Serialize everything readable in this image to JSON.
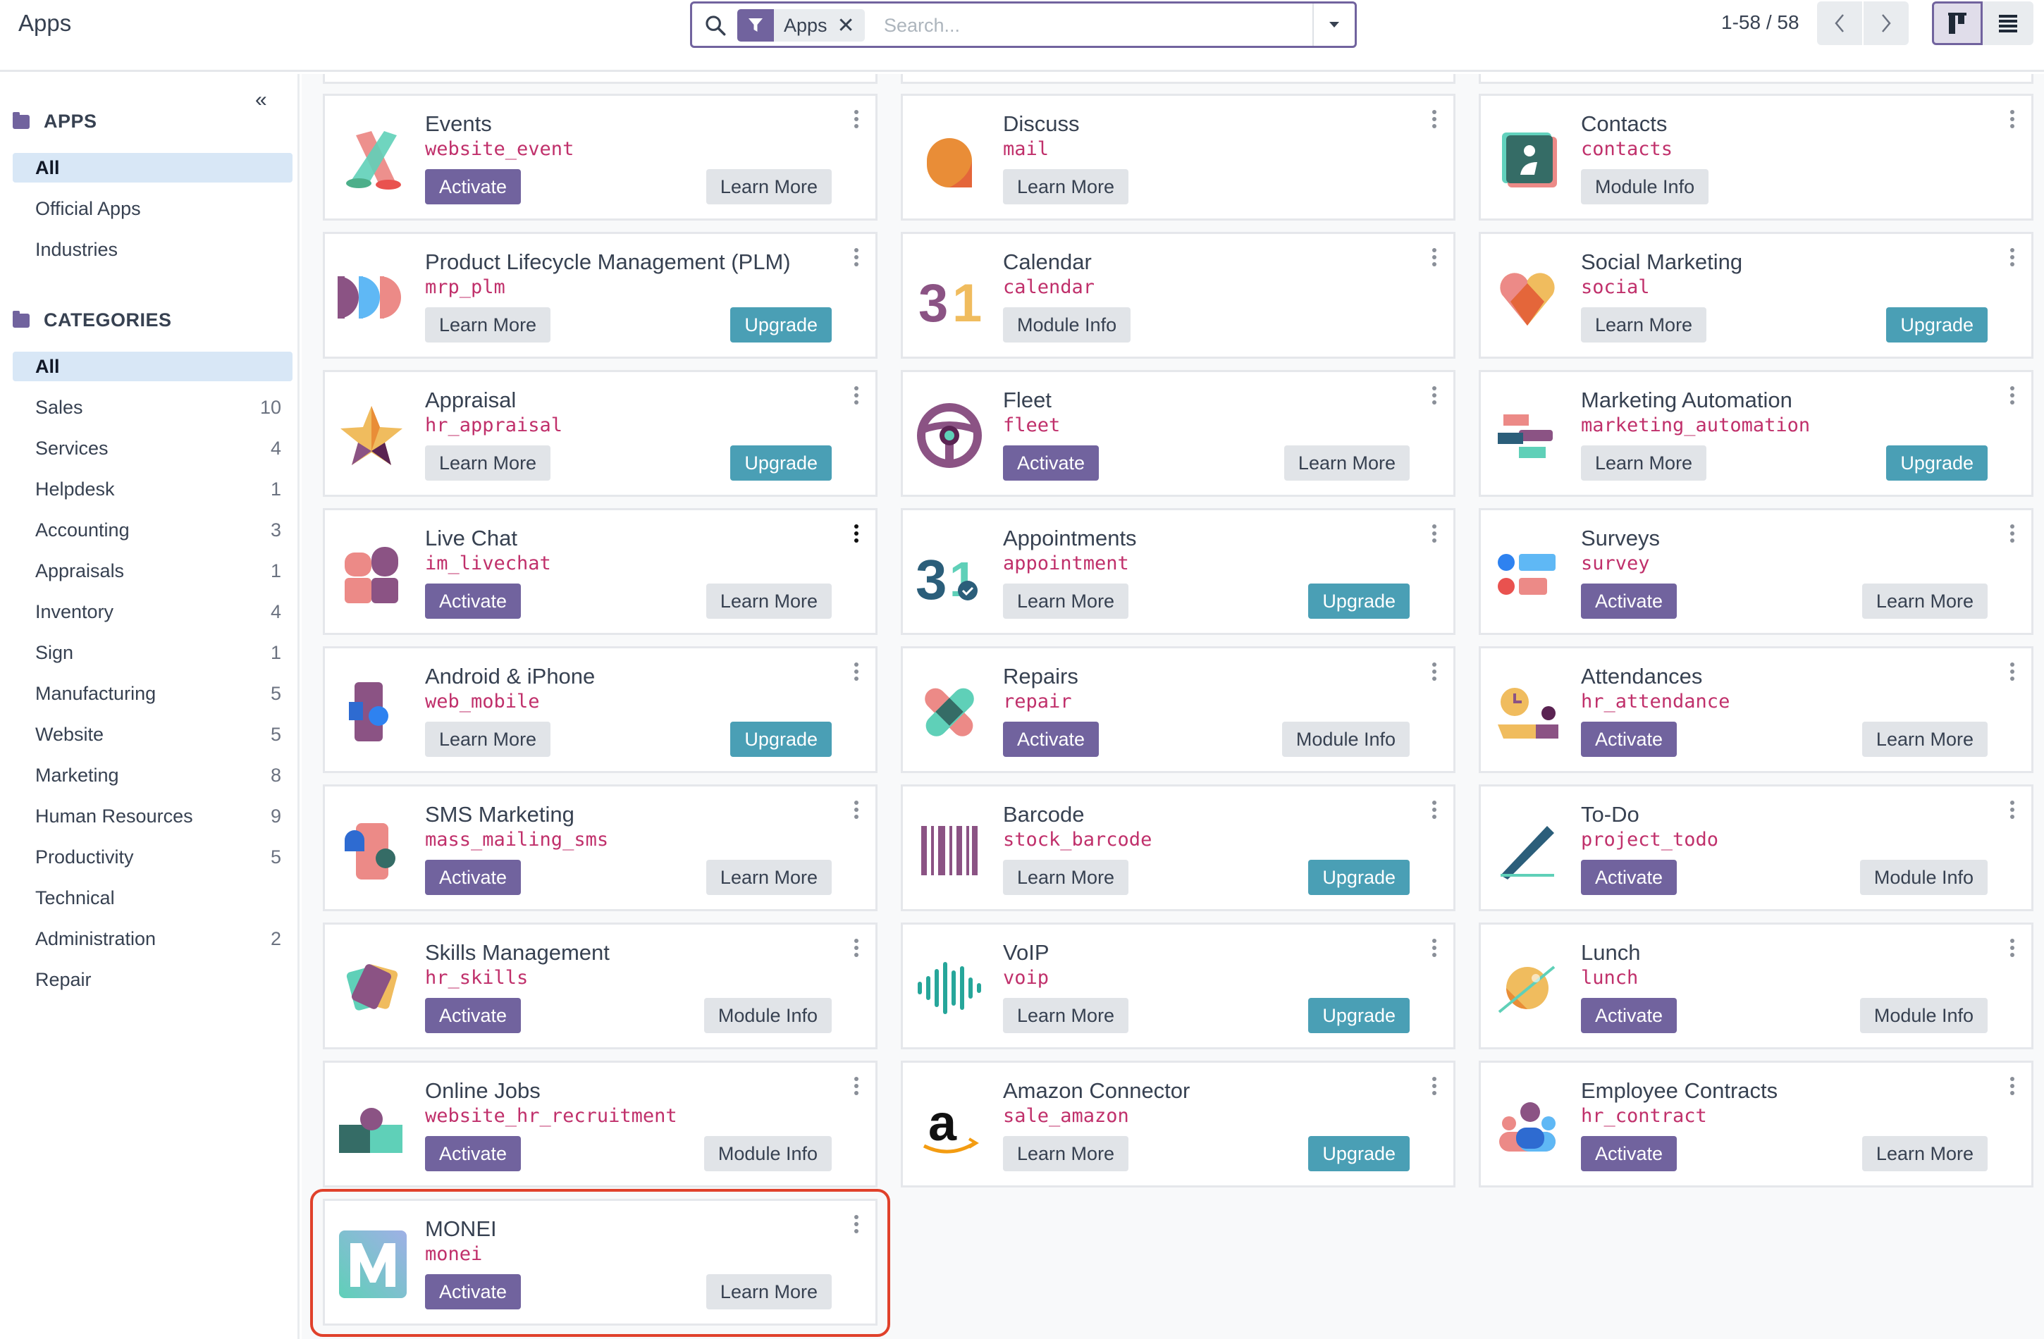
{
  "header": {
    "title": "Apps",
    "search": {
      "facet_label": "Apps",
      "placeholder": "Search...",
      "value": ""
    },
    "pager": "1-58 / 58"
  },
  "sidebar": {
    "apps_title": "APPS",
    "apps_items": [
      {
        "label": "All",
        "active": true
      },
      {
        "label": "Official Apps",
        "active": false
      },
      {
        "label": "Industries",
        "active": false
      }
    ],
    "categories_title": "CATEGORIES",
    "categories": [
      {
        "label": "All",
        "count": "",
        "active": true
      },
      {
        "label": "Sales",
        "count": "10"
      },
      {
        "label": "Services",
        "count": "4"
      },
      {
        "label": "Helpdesk",
        "count": "1"
      },
      {
        "label": "Accounting",
        "count": "3"
      },
      {
        "label": "Appraisals",
        "count": "1"
      },
      {
        "label": "Inventory",
        "count": "4"
      },
      {
        "label": "Sign",
        "count": "1"
      },
      {
        "label": "Manufacturing",
        "count": "5"
      },
      {
        "label": "Website",
        "count": "5"
      },
      {
        "label": "Marketing",
        "count": "8"
      },
      {
        "label": "Human Resources",
        "count": "9"
      },
      {
        "label": "Productivity",
        "count": "5"
      },
      {
        "label": "Technical",
        "count": ""
      },
      {
        "label": "Administration",
        "count": "2"
      },
      {
        "label": "Repair",
        "count": ""
      }
    ]
  },
  "colors": {
    "primary": "#71639e",
    "upgrade": "#4a9fb5",
    "technical_name": "#c0306b",
    "highlight": "#e0412b"
  },
  "apps": [
    {
      "name": "Events",
      "tech": "website_event",
      "icon": "events-icon",
      "left": {
        "label": "Activate",
        "kind": "activate"
      },
      "right": {
        "label": "Learn More",
        "kind": "grey"
      }
    },
    {
      "name": "Discuss",
      "tech": "mail",
      "icon": "discuss-icon",
      "left": {
        "label": "Learn More",
        "kind": "grey"
      },
      "right": null
    },
    {
      "name": "Contacts",
      "tech": "contacts",
      "icon": "contacts-icon",
      "left": {
        "label": "Module Info",
        "kind": "grey"
      },
      "right": null
    },
    {
      "name": "Product Lifecycle Management (PLM)",
      "tech": "mrp_plm",
      "icon": "plm-icon",
      "left": {
        "label": "Learn More",
        "kind": "grey"
      },
      "right": {
        "label": "Upgrade",
        "kind": "upgrade"
      }
    },
    {
      "name": "Calendar",
      "tech": "calendar",
      "icon": "calendar-icon",
      "left": {
        "label": "Module Info",
        "kind": "grey"
      },
      "right": null
    },
    {
      "name": "Social Marketing",
      "tech": "social",
      "icon": "social-marketing-icon",
      "left": {
        "label": "Learn More",
        "kind": "grey"
      },
      "right": {
        "label": "Upgrade",
        "kind": "upgrade"
      }
    },
    {
      "name": "Appraisal",
      "tech": "hr_appraisal",
      "icon": "appraisal-icon",
      "left": {
        "label": "Learn More",
        "kind": "grey"
      },
      "right": {
        "label": "Upgrade",
        "kind": "upgrade"
      }
    },
    {
      "name": "Fleet",
      "tech": "fleet",
      "icon": "fleet-icon",
      "left": {
        "label": "Activate",
        "kind": "activate"
      },
      "right": {
        "label": "Learn More",
        "kind": "grey"
      }
    },
    {
      "name": "Marketing Automation",
      "tech": "marketing_automation",
      "icon": "marketing-automation-icon",
      "left": {
        "label": "Learn More",
        "kind": "grey"
      },
      "right": {
        "label": "Upgrade",
        "kind": "upgrade"
      }
    },
    {
      "name": "Live Chat",
      "tech": "im_livechat",
      "icon": "live-chat-icon",
      "left": {
        "label": "Activate",
        "kind": "activate"
      },
      "right": {
        "label": "Learn More",
        "kind": "grey"
      }
    },
    {
      "name": "Appointments",
      "tech": "appointment",
      "icon": "appointments-icon",
      "left": {
        "label": "Learn More",
        "kind": "grey"
      },
      "right": {
        "label": "Upgrade",
        "kind": "upgrade"
      }
    },
    {
      "name": "Surveys",
      "tech": "survey",
      "icon": "surveys-icon",
      "left": {
        "label": "Activate",
        "kind": "activate"
      },
      "right": {
        "label": "Learn More",
        "kind": "grey"
      }
    },
    {
      "name": "Android & iPhone",
      "tech": "web_mobile",
      "icon": "mobile-icon",
      "left": {
        "label": "Learn More",
        "kind": "grey"
      },
      "right": {
        "label": "Upgrade",
        "kind": "upgrade"
      }
    },
    {
      "name": "Repairs",
      "tech": "repair",
      "icon": "repairs-icon",
      "left": {
        "label": "Activate",
        "kind": "activate"
      },
      "right": {
        "label": "Module Info",
        "kind": "grey"
      }
    },
    {
      "name": "Attendances",
      "tech": "hr_attendance",
      "icon": "attendances-icon",
      "left": {
        "label": "Activate",
        "kind": "activate"
      },
      "right": {
        "label": "Learn More",
        "kind": "grey"
      }
    },
    {
      "name": "SMS Marketing",
      "tech": "mass_mailing_sms",
      "icon": "sms-marketing-icon",
      "left": {
        "label": "Activate",
        "kind": "activate"
      },
      "right": {
        "label": "Learn More",
        "kind": "grey"
      }
    },
    {
      "name": "Barcode",
      "tech": "stock_barcode",
      "icon": "barcode-icon",
      "left": {
        "label": "Learn More",
        "kind": "grey"
      },
      "right": {
        "label": "Upgrade",
        "kind": "upgrade"
      }
    },
    {
      "name": "To-Do",
      "tech": "project_todo",
      "icon": "todo-icon",
      "left": {
        "label": "Activate",
        "kind": "activate"
      },
      "right": {
        "label": "Module Info",
        "kind": "grey"
      }
    },
    {
      "name": "Skills Management",
      "tech": "hr_skills",
      "icon": "skills-icon",
      "left": {
        "label": "Activate",
        "kind": "activate"
      },
      "right": {
        "label": "Module Info",
        "kind": "grey"
      }
    },
    {
      "name": "VoIP",
      "tech": "voip",
      "icon": "voip-icon",
      "left": {
        "label": "Learn More",
        "kind": "grey"
      },
      "right": {
        "label": "Upgrade",
        "kind": "upgrade"
      }
    },
    {
      "name": "Lunch",
      "tech": "lunch",
      "icon": "lunch-icon",
      "left": {
        "label": "Activate",
        "kind": "activate"
      },
      "right": {
        "label": "Module Info",
        "kind": "grey"
      }
    },
    {
      "name": "Online Jobs",
      "tech": "website_hr_recruitment",
      "icon": "online-jobs-icon",
      "left": {
        "label": "Activate",
        "kind": "activate"
      },
      "right": {
        "label": "Module Info",
        "kind": "grey"
      }
    },
    {
      "name": "Amazon Connector",
      "tech": "sale_amazon",
      "icon": "amazon-icon",
      "left": {
        "label": "Learn More",
        "kind": "grey"
      },
      "right": {
        "label": "Upgrade",
        "kind": "upgrade"
      }
    },
    {
      "name": "Employee Contracts",
      "tech": "hr_contract",
      "icon": "employee-contracts-icon",
      "left": {
        "label": "Activate",
        "kind": "activate"
      },
      "right": {
        "label": "Learn More",
        "kind": "grey"
      }
    },
    {
      "name": "MONEI",
      "tech": "monei",
      "icon": "monei-icon",
      "left": {
        "label": "Activate",
        "kind": "activate"
      },
      "right": {
        "label": "Learn More",
        "kind": "grey"
      },
      "highlighted": true
    }
  ]
}
